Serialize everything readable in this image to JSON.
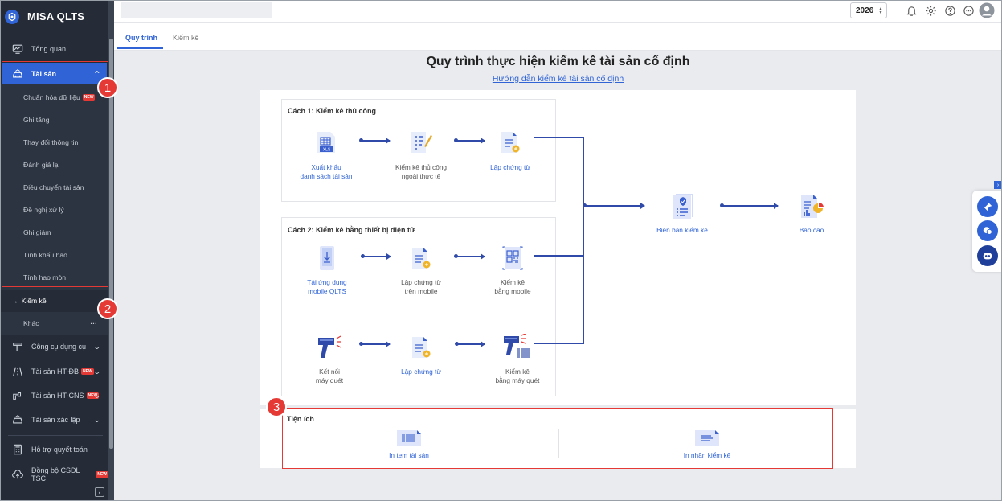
{
  "app": {
    "name": "MISA QLTS"
  },
  "sidebar": {
    "top_items": [
      {
        "label": "Tổng quan",
        "icon": "monitor-icon"
      },
      {
        "label": "Tài sản",
        "icon": "car-icon"
      }
    ],
    "sub_items": [
      {
        "label": "Chuẩn hóa dữ liệu",
        "badge": "NEW"
      },
      {
        "label": "Ghi tăng"
      },
      {
        "label": "Thay đổi thông tin"
      },
      {
        "label": "Đánh giá lại"
      },
      {
        "label": "Điều chuyển tài sản"
      },
      {
        "label": "Đề nghị xử lý"
      },
      {
        "label": "Ghi giảm"
      },
      {
        "label": "Tính khấu hao"
      },
      {
        "label": "Tính hao mòn"
      },
      {
        "label": "Kiểm kê",
        "prefix": "→"
      },
      {
        "label": "Khác",
        "more": "···"
      }
    ],
    "groups": [
      {
        "label": "Công cụ dụng cụ",
        "icon": "tools-icon"
      },
      {
        "label": "Tài sản HT-ĐB",
        "badge": "NEW",
        "icon": "road-icon"
      },
      {
        "label": "Tài sản HT-CNS",
        "badge": "NEW",
        "icon": "water-tap-icon"
      },
      {
        "label": "Tài sản xác lập",
        "icon": "car-outline-icon"
      }
    ],
    "bottom_items": [
      {
        "label": "Hỗ trợ quyết toán",
        "icon": "calculator-icon"
      },
      {
        "label": "Đồng bộ CSDL TSC",
        "badge": "NEW",
        "icon": "cloud-upload-icon"
      }
    ],
    "collapse_glyph": "‹"
  },
  "topbar": {
    "year": "2026",
    "year_spin": "▲▼"
  },
  "tabs": [
    {
      "label": "Quy trình",
      "active": true
    },
    {
      "label": "Kiểm kê",
      "active": false
    }
  ],
  "main": {
    "title": "Quy trình thực hiện kiểm kê tài sản cố định",
    "guide_link": "Hướng dẫn kiểm kê tài sản cố định",
    "method1": {
      "title": "Cách 1: Kiểm kê thủ công",
      "steps": [
        {
          "label": "Xuất khẩu\ndanh sách tài sản",
          "icon": "excel-export-icon"
        },
        {
          "label": "Kiểm kê thủ công\nngoài thực tế",
          "icon": "checklist-icon"
        },
        {
          "label": "Lập chứng từ",
          "icon": "document-icon"
        }
      ]
    },
    "method2": {
      "title": "Cách 2: Kiểm kê bằng thiết bị điện tử",
      "steps_mobile": [
        {
          "label": "Tải ứng dụng\nmobile QLTS",
          "icon": "mobile-download-icon"
        },
        {
          "label": "Lập chứng từ\ntrên mobile",
          "icon": "document-icon"
        },
        {
          "label": "Kiểm kê\nbằng mobile",
          "icon": "qr-mobile-icon"
        }
      ],
      "steps_scanner": [
        {
          "label": "Kết nối\nmáy quét",
          "icon": "scanner-icon"
        },
        {
          "label": "Lập chứng từ",
          "icon": "document-icon"
        },
        {
          "label": "Kiểm kê\nbằng máy quét",
          "icon": "barcode-scanner-icon"
        }
      ]
    },
    "result_steps": [
      {
        "label": "Biên bản kiểm kê",
        "icon": "report-shield-icon"
      },
      {
        "label": "Báo cáo",
        "icon": "chart-report-icon"
      }
    ],
    "utilities": {
      "title": "Tiện ích",
      "items": [
        {
          "label": "In tem tài sản",
          "icon": "barcode-label-icon"
        },
        {
          "label": "In nhãn kiểm kê",
          "icon": "label-icon"
        }
      ]
    }
  },
  "markers": [
    "1",
    "2",
    "3"
  ],
  "colors": {
    "accent": "#2f63d6",
    "sidebar_bg": "#252c38",
    "highlight": "#e53935",
    "connector": "#2f4aa8"
  }
}
